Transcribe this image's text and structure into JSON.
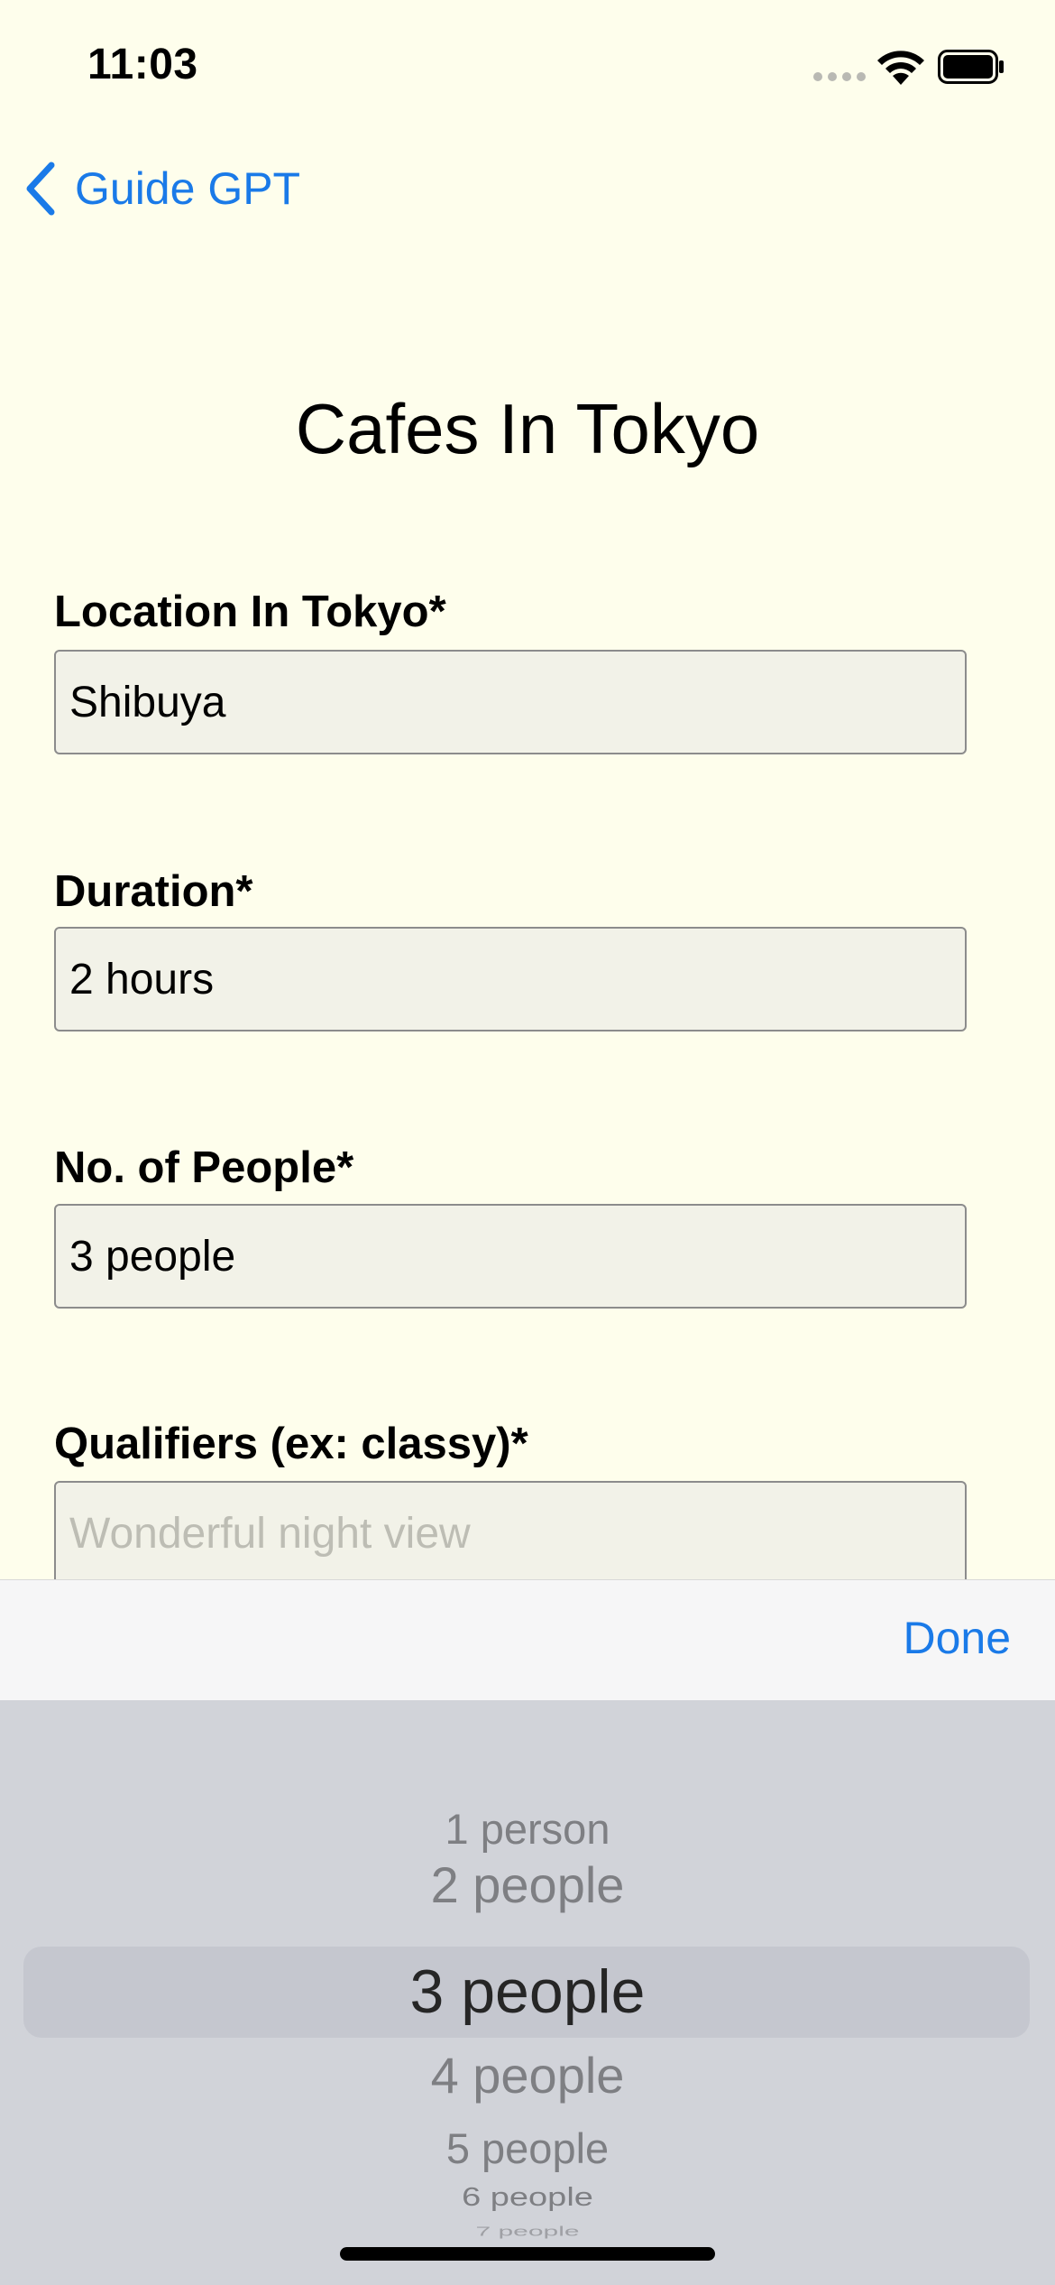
{
  "status_bar": {
    "time": "11:03"
  },
  "nav": {
    "back_label": "Guide GPT"
  },
  "page": {
    "title": "Cafes In Tokyo"
  },
  "form": {
    "fields": [
      {
        "label": "Location In Tokyo*",
        "value": "Shibuya",
        "placeholder": ""
      },
      {
        "label": "Duration*",
        "value": "2 hours",
        "placeholder": ""
      },
      {
        "label": "No. of People*",
        "value": "3 people",
        "placeholder": ""
      },
      {
        "label": "Qualifiers (ex: classy)*",
        "value": "",
        "placeholder": "Wonderful night view"
      }
    ]
  },
  "toolbar": {
    "done_label": "Done"
  },
  "picker": {
    "options": [
      "1 person",
      "2 people",
      "3 people",
      "4 people",
      "5 people",
      "6 people",
      "7 people"
    ],
    "selected": "3 people"
  },
  "colors": {
    "background": "#fefeec",
    "accent": "#1a7ae8",
    "picker_bg": "#d1d3d9"
  }
}
